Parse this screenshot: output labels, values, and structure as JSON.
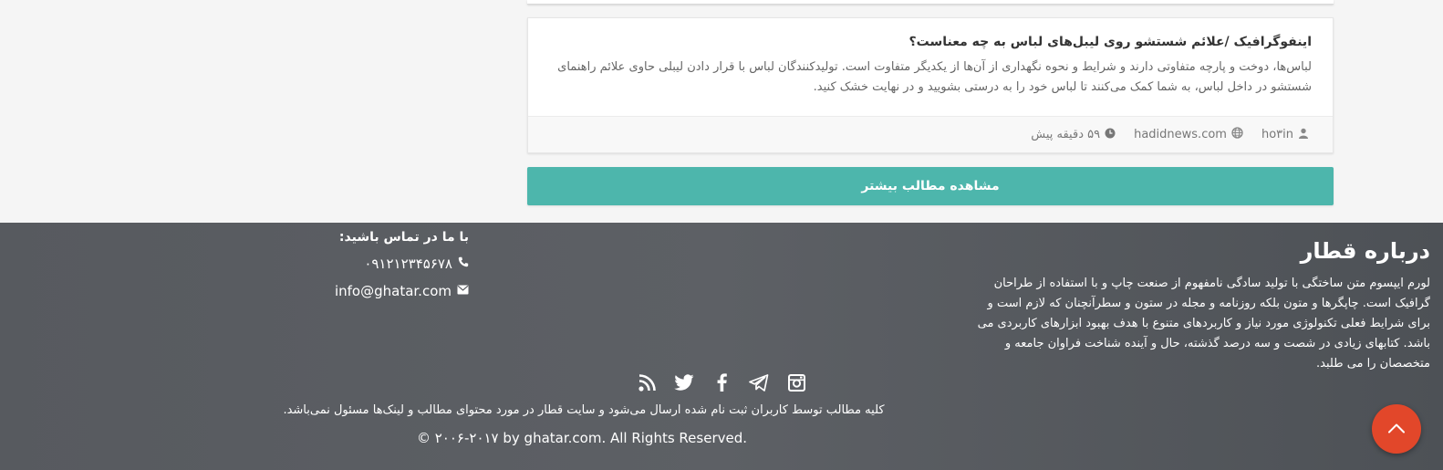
{
  "post": {
    "title": "اینفوگرافیک /علائم شستشو روی لیبل‌های لباس به چه معناست؟",
    "excerpt": "لباس‌ها، دوخت و پارچه متفاوتی دارند و شرایط و نحوه نگهداری از آن‌ها از یکدیگر متفاوت است. تولیدکنندگان لباس با قرار دادن لیبلی حاوی علائم راهنمای شستشو در داخل لباس، به شما کمک می‌کنند تا لباس خود را به درستی بشویید و در نهایت خشک کنید.",
    "author": "ho۳in",
    "source": "hadidnews.com",
    "time": "۵۹ دقیقه پیش",
    "author_icon": "user-icon",
    "source_icon": "globe-icon",
    "time_icon": "clock-icon"
  },
  "more_button": "مشاهده مطالب بیشتر",
  "footer": {
    "about": {
      "title": "درباره قطار",
      "text": "لورم ایپسوم متن ساختگی با تولید سادگی نامفهوم از صنعت چاپ و با استفاده از طراحان گرافیک است. چاپگرها و متون بلکه روزنامه و مجله در ستون و سطرآنچنان که لازم است و برای شرایط فعلی تکنولوژی مورد نیاز و کاربردهای متنوع با هدف بهبود ابزارهای کاربردی می باشد. کتابهای زیادی در شصت و سه درصد گذشته، حال و آینده شناخت فراوان جامعه و متخصصان را می طلبد."
    },
    "contact": {
      "title": "با ما در تماس باشید:",
      "phone": "۰۹۱۲۱۲۳۴۵۶۷۸",
      "email": "info@ghatar.com",
      "phone_icon": "phone-icon",
      "email_icon": "envelope-icon"
    },
    "social": [
      "rss-icon",
      "twitter-icon",
      "facebook-icon",
      "telegram-icon",
      "instagram-icon"
    ],
    "disclaimer": "کلیه مطالب توسط کاربران ثبت نام شده ارسال می‌شود و سایت قطار در مورد محتوای مطالب و لینک‌ها مسئول نمی‌باشد.",
    "copyright": "© ۲۰۰۶-۲۰۱۷ by ghatar.com. All Rights Reserved."
  },
  "colors": {
    "accent": "#4db6ac",
    "footer_bg": "#5a5d62",
    "to_top": "#e2472a"
  }
}
